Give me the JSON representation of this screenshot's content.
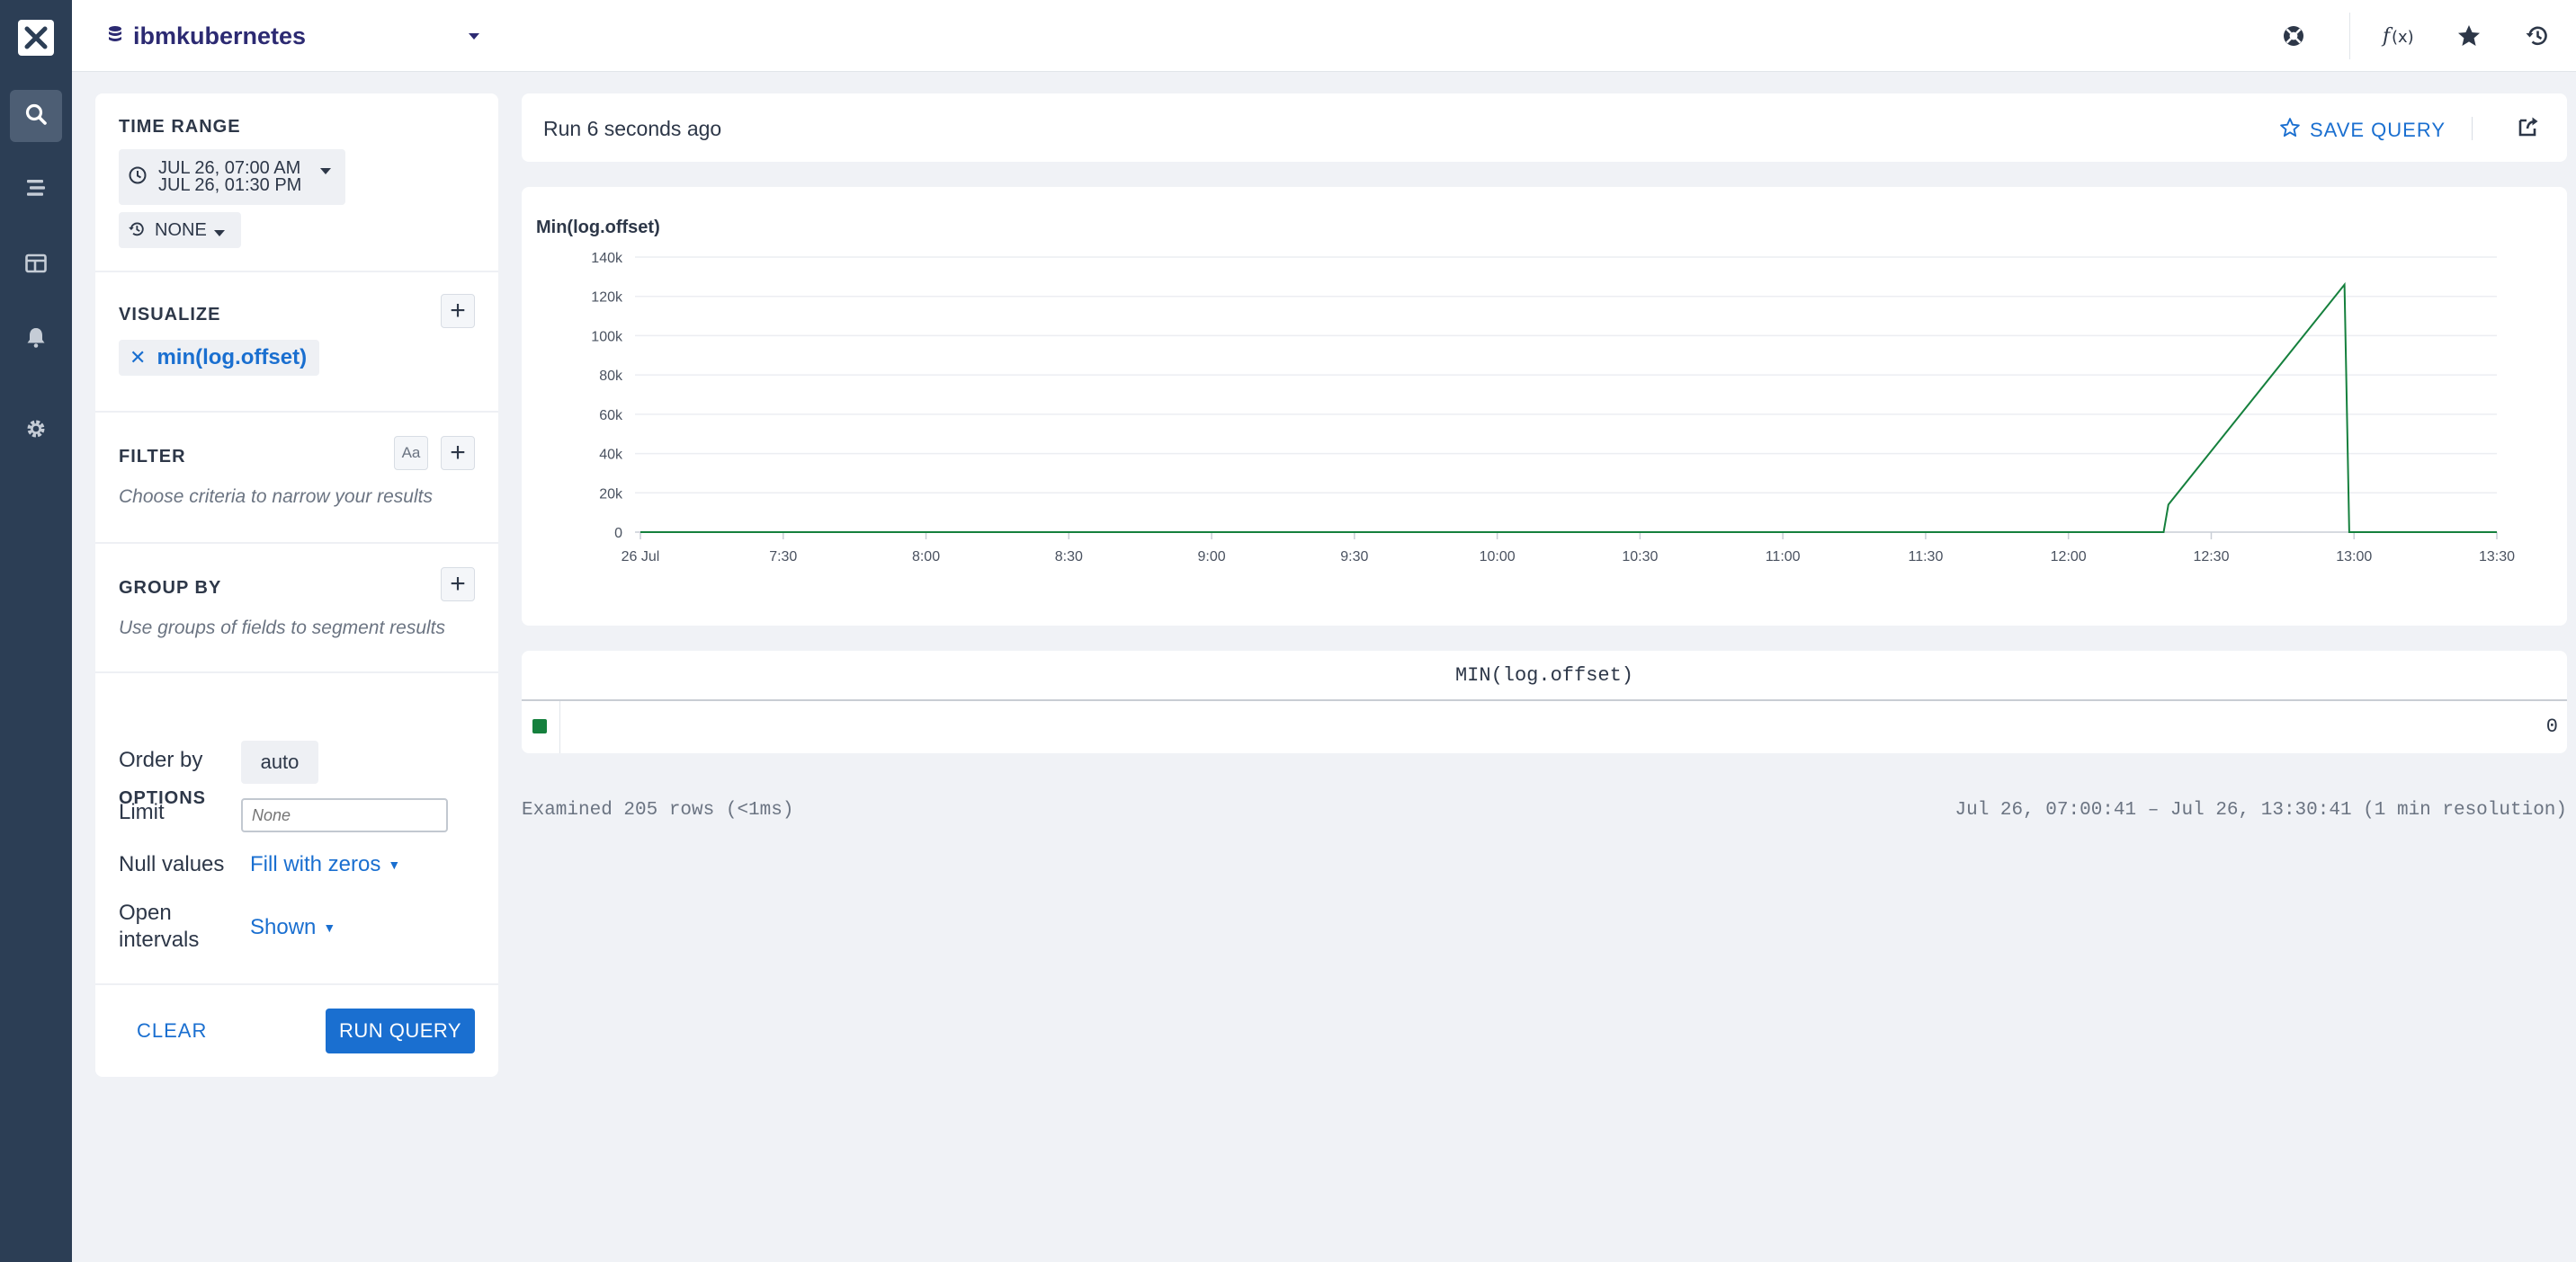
{
  "dataset": {
    "name": "ibmkubernetes"
  },
  "time_range": {
    "title": "TIME RANGE",
    "start": "JUL 26, 07:00 AM",
    "end": "JUL 26, 01:30 PM",
    "compare": "NONE"
  },
  "visualize": {
    "title": "VISUALIZE",
    "items": [
      "min(log.offset)"
    ]
  },
  "filter": {
    "title": "FILTER",
    "hint": "Choose criteria to narrow your results",
    "case_label": "Aa"
  },
  "group_by": {
    "title": "GROUP BY",
    "hint": "Use groups of fields to segment results"
  },
  "options": {
    "title": "OPTIONS",
    "order_by_label": "Order by",
    "order_by_value": "auto",
    "limit_label": "Limit",
    "limit_placeholder": "None",
    "null_values_label": "Null values",
    "null_values_value": "Fill with zeros",
    "open_intervals_label_1": "Open",
    "open_intervals_label_2": "intervals",
    "open_intervals_value": "Shown"
  },
  "actions": {
    "clear": "CLEAR",
    "run": "RUN QUERY"
  },
  "run_status": "Run 6 seconds ago",
  "save_query": "SAVE QUERY",
  "chart_data": {
    "type": "line",
    "title": "Min(log.offset)",
    "x_tick_labels": [
      "26 Jul",
      "7:30",
      "8:00",
      "8:30",
      "9:00",
      "9:30",
      "10:00",
      "10:30",
      "11:00",
      "11:30",
      "12:00",
      "12:30",
      "13:00",
      "13:30"
    ],
    "y_tick_labels": [
      "0",
      "20k",
      "40k",
      "60k",
      "80k",
      "100k",
      "120k",
      "140k"
    ],
    "ylim": [
      0,
      140000
    ],
    "x_range": [
      "07:00",
      "13:30"
    ],
    "series": [
      {
        "color": "#15803d",
        "points": [
          [
            "07:00",
            0
          ],
          [
            "08:00",
            0
          ],
          [
            "09:00",
            0
          ],
          [
            "10:00",
            0
          ],
          [
            "11:00",
            0
          ],
          [
            "12:00",
            0
          ],
          [
            "12:20",
            0
          ],
          [
            "12:21",
            14000
          ],
          [
            "12:58",
            126000
          ],
          [
            "12:59",
            0
          ],
          [
            "13:00",
            0
          ],
          [
            "13:30",
            0
          ]
        ]
      }
    ],
    "grid": true
  },
  "table": {
    "header": "MIN(log.offset)",
    "value": "0",
    "swatch_color": "#15803d"
  },
  "footer": {
    "examined": "Examined 205 rows (<1ms)",
    "range": "Jul 26, 07:00:41 – Jul 26, 13:30:41 (1 min resolution)"
  },
  "icons": {
    "rail": [
      "close-logo-icon",
      "search-icon",
      "datasets-icon",
      "boards-icon",
      "triggers-bell-icon",
      "settings-gear-icon"
    ],
    "topbar": [
      "support-icon",
      "function-icon",
      "star-icon",
      "history-icon"
    ]
  }
}
